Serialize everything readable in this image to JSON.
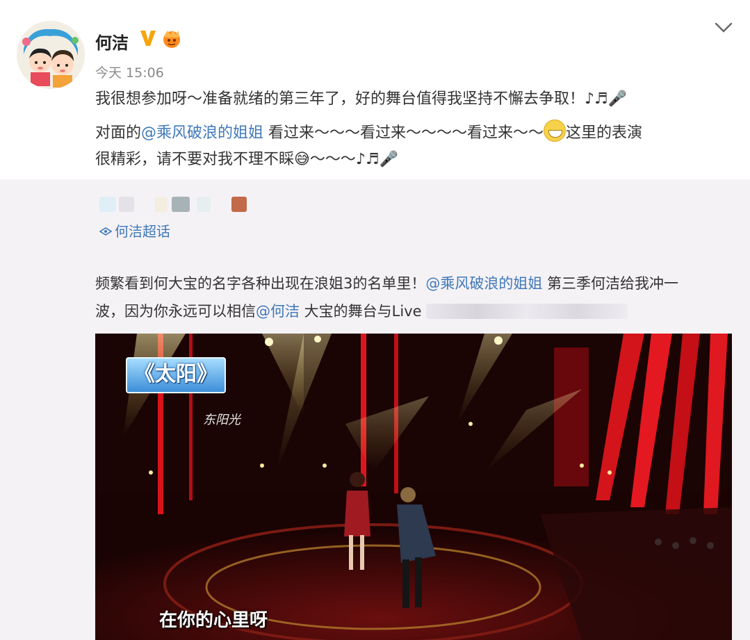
{
  "post": {
    "author": "何洁",
    "time": "今天 15:06",
    "line1": "我很想参加呀～准备就绪的第三年了，好的舞台值得我坚持不懈去争取！♪♬🎤",
    "line2_pre": "对面的",
    "line2_mention": "@乘风破浪的姐姐",
    "line2_post": " 看过来～～～看过来～～～～看过来～～",
    "line2_tail": "这里的表演",
    "line3": "很精彩，请不要对我不理不睬😅～～～♪♬🎤"
  },
  "repost": {
    "topic": "何洁超话",
    "line1_pre": "频繁看到何大宝的名字各种出现在浪姐3的名单里！",
    "line1_mention": "@乘风破浪的姐姐",
    "line1_post": " 第三季何洁给我冲一",
    "line2_pre": "波，因为你永远可以相信",
    "line2_mention": "@何洁",
    "line2_post": " 大宝的舞台与Live"
  },
  "video": {
    "song_title": "《太阳》",
    "sponsor": "东阳光",
    "lyric": "在你的心里呀"
  },
  "colors": {
    "link": "#3f78b8",
    "repost_bg": "#f5f2f6"
  }
}
